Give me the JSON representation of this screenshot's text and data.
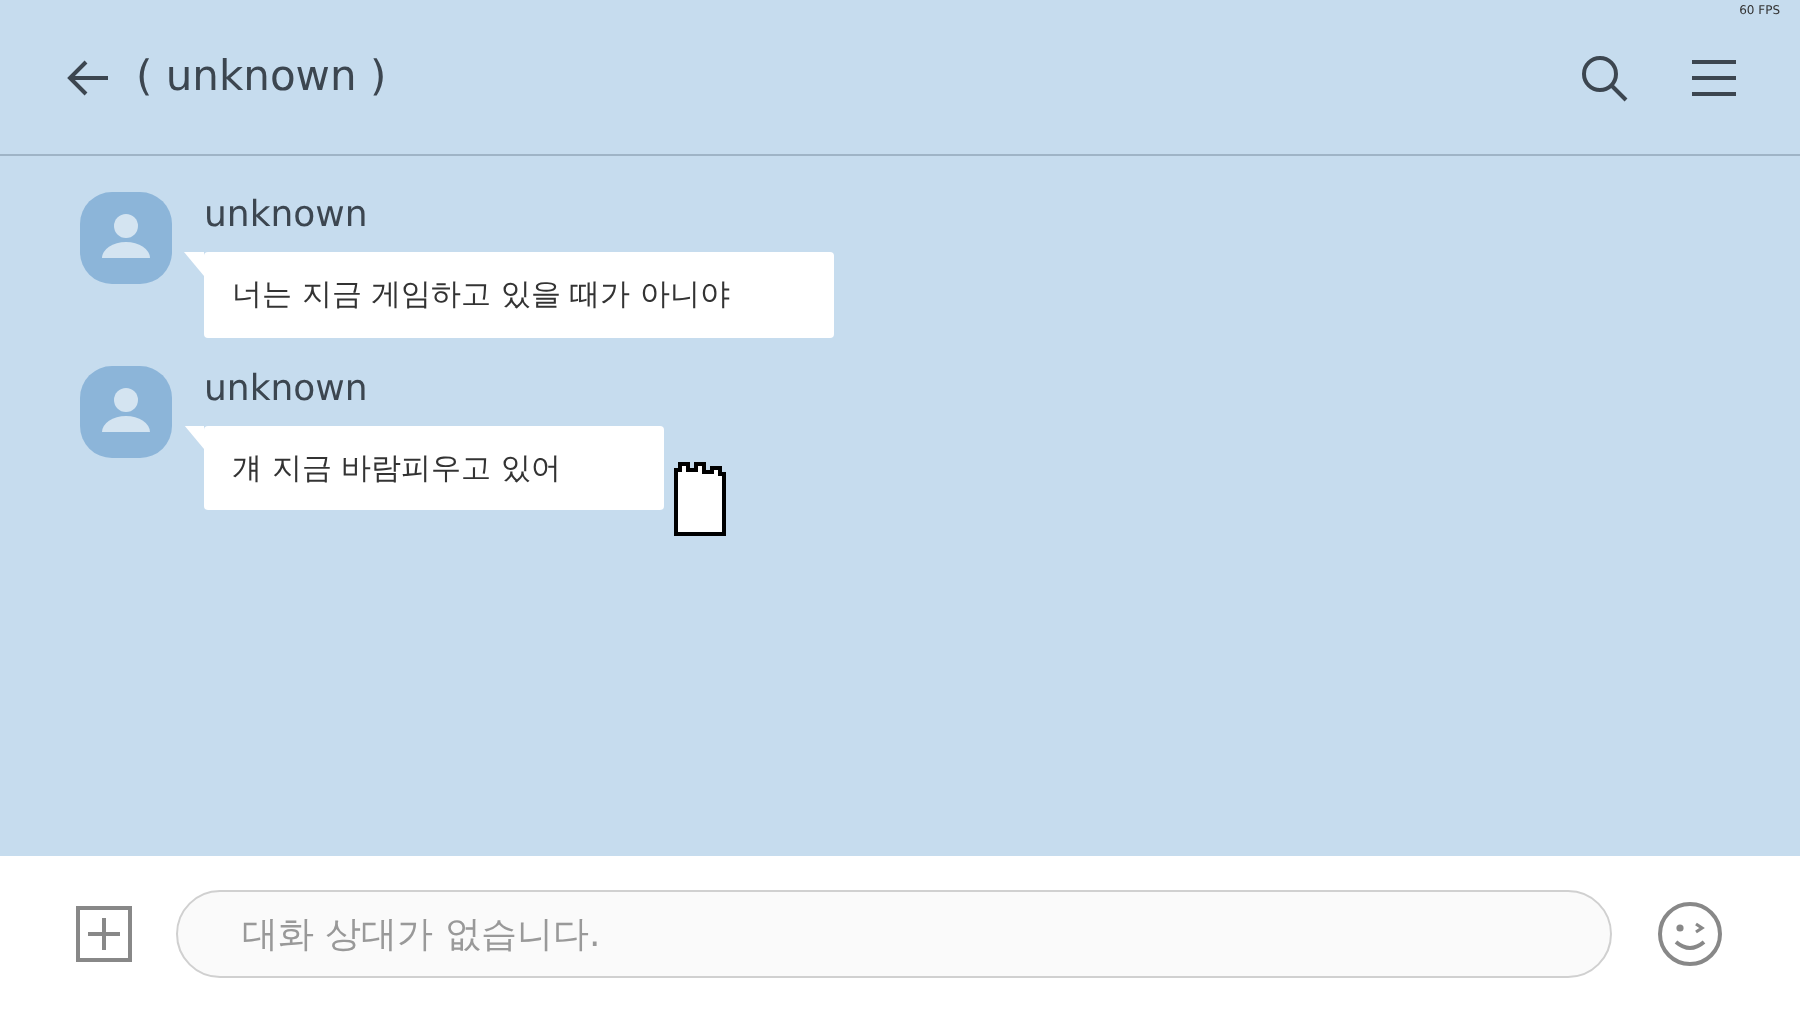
{
  "fps_counter": "60 FPS",
  "header": {
    "title": "( unknown )"
  },
  "messages": [
    {
      "sender": "unknown",
      "text": "너는 지금 게임하고 있을 때가 아니야"
    },
    {
      "sender": "unknown",
      "text": "걔 지금 바람피우고 있어"
    }
  ],
  "composer": {
    "placeholder": "대화 상대가 없습니다.",
    "disabled": true
  }
}
